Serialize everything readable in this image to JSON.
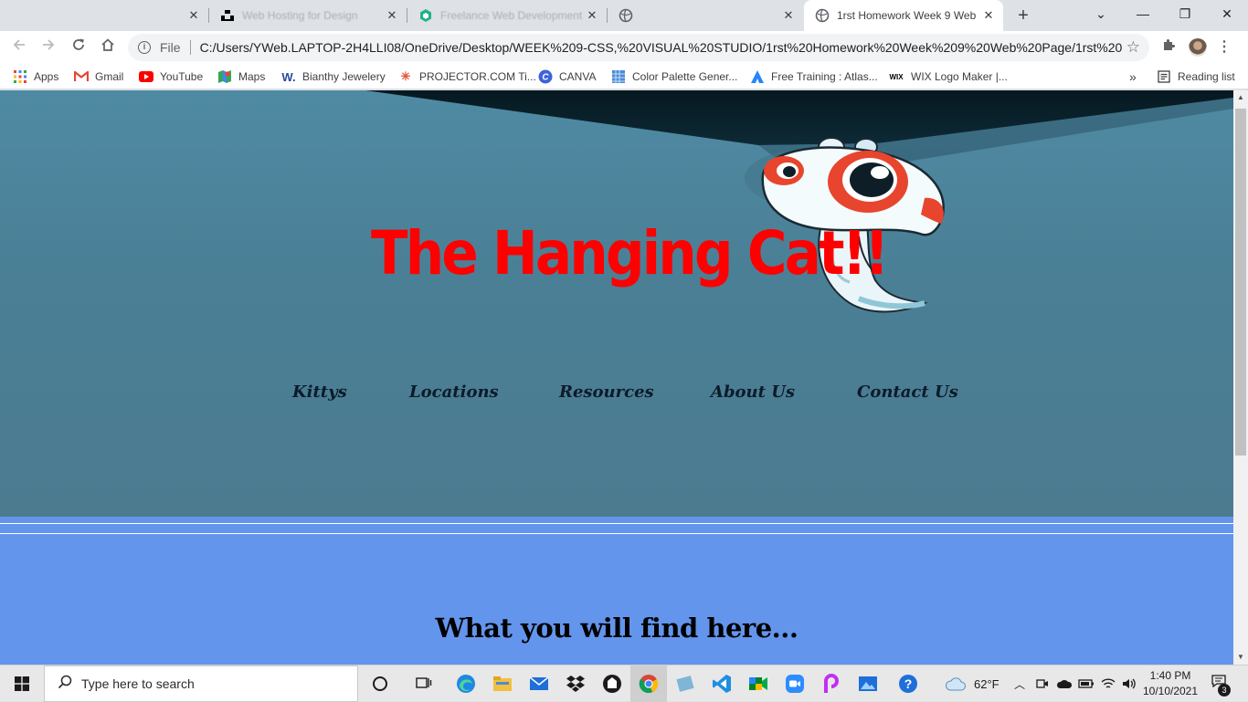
{
  "browser": {
    "tabs": [
      {
        "title": "",
        "icon": "blank-icon",
        "active": false
      },
      {
        "title": "Web Hosting for Design",
        "icon": "unsplash-icon",
        "active": false
      },
      {
        "title": "Freelance Web Development",
        "icon": "hexagon-icon",
        "active": false
      },
      {
        "title": "",
        "icon": "globe-icon",
        "active": false
      },
      {
        "title": "1rst Homework Week 9 Web",
        "icon": "globe-icon",
        "active": true
      }
    ],
    "new_tab": "+",
    "window_controls": {
      "dropdown": "⌄",
      "minimize": "—",
      "restore": "❐",
      "close": "✕"
    },
    "tab_close": "✕",
    "address": {
      "scheme": "File",
      "url": "C:/Users/YWeb.LAPTOP-2H4LLI08/OneDrive/Desktop/WEEK%209-CSS,%20VISUAL%20STUDIO/1rst%20Homework%20Week%209%20Web%20Page/1rst%20Hom..."
    },
    "bookmarks": [
      {
        "label": "Apps",
        "icon": "apps-grid-icon"
      },
      {
        "label": "Gmail",
        "icon": "gmail-icon"
      },
      {
        "label": "YouTube",
        "icon": "youtube-icon"
      },
      {
        "label": "Maps",
        "icon": "maps-icon"
      },
      {
        "label": "Bianthy Jewelery",
        "icon": "w-icon"
      },
      {
        "label": "PROJECTOR.COM Ti...",
        "icon": "projector-icon"
      },
      {
        "label": "CANVA",
        "icon": "canva-icon"
      },
      {
        "label": "Color Palette Gener...",
        "icon": "palette-icon"
      },
      {
        "label": "Free Training : Atlas...",
        "icon": "atlassian-icon"
      },
      {
        "label": "WIX Logo Maker |...",
        "icon": "wix-icon"
      }
    ],
    "bookmarks_overflow": "»",
    "reading_list": "Reading list"
  },
  "page": {
    "title": "The Hanging Cat!!",
    "nav": [
      "Kittys",
      "Locations",
      "Resources",
      "About Us",
      "Contact Us"
    ],
    "section_heading": "What you will find here...",
    "colors": {
      "title": "#ff0000",
      "hero": "#4a7f95",
      "body": "#6495ed"
    }
  },
  "taskbar": {
    "search_placeholder": "Type here to search",
    "weather": "62°F",
    "time": "1:40 PM",
    "date": "10/10/2021",
    "notification_count": "3"
  }
}
